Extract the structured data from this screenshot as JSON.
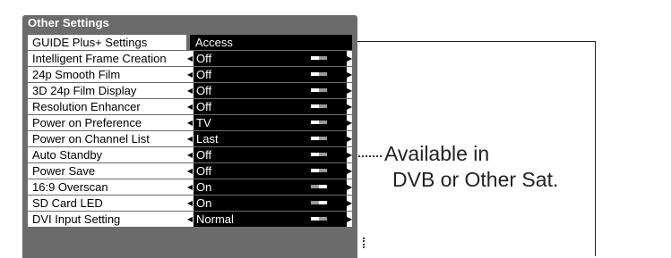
{
  "menu": {
    "title": "Other Settings",
    "rows": [
      {
        "label": "GUIDE Plus+ Settings",
        "value": "Access",
        "type": "action"
      },
      {
        "label": "Intelligent Frame Creation",
        "value": "Off",
        "type": "option",
        "indicator_level": 0.0
      },
      {
        "label": "24p Smooth Film",
        "value": "Off",
        "type": "option",
        "indicator_level": 0.0
      },
      {
        "label": "3D 24p Film Display",
        "value": "Off",
        "type": "option",
        "indicator_level": 0.0
      },
      {
        "label": "Resolution Enhancer",
        "value": "Off",
        "type": "option",
        "indicator_level": 0.0
      },
      {
        "label": "Power on Preference",
        "value": "TV",
        "type": "option",
        "indicator_level": 0.0
      },
      {
        "label": "Power on Channel List",
        "value": "Last",
        "type": "option",
        "indicator_level": 0.0
      },
      {
        "label": "Auto Standby",
        "value": "Off",
        "type": "option",
        "indicator_level": 0.0
      },
      {
        "label": "Power Save",
        "value": "Off",
        "type": "option",
        "indicator_level": 0.0
      },
      {
        "label": "16:9 Overscan",
        "value": "On",
        "type": "option",
        "indicator_level": 1.0
      },
      {
        "label": "SD Card LED",
        "value": "On",
        "type": "option",
        "indicator_level": 1.0
      },
      {
        "label": "DVI Input Setting",
        "value": "Normal",
        "type": "option",
        "indicator_level": 0.0
      }
    ]
  },
  "annotation": {
    "line1": "Available in",
    "line2": "DVB or Other Sat."
  },
  "colors": {
    "menu_bg": "#6b6b6b",
    "value_bg": "#000000",
    "label_bg": "#ffffff"
  }
}
